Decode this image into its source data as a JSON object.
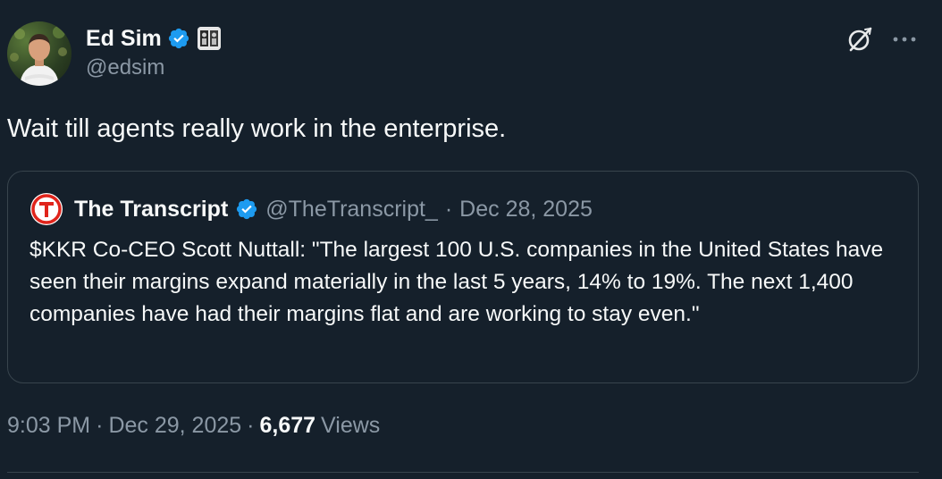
{
  "author": {
    "display_name": "Ed Sim",
    "handle": "@edsim",
    "avatar_icon": "avatar-photo",
    "verified_icon": "verified-badge-icon",
    "affiliation_icon": "affiliation-badge-icon"
  },
  "actions": {
    "grok_icon": "grok-icon",
    "more_icon": "more-icon"
  },
  "tweet": {
    "text": "Wait till agents really work in the enterprise."
  },
  "quote": {
    "display_name": "The Transcript",
    "handle": "@TheTranscript_",
    "separator": "·",
    "date": "Dec 28, 2025",
    "text": "$KKR Co-CEO Scott Nuttall: \"The largest 100 U.S. companies in the United States have seen their margins expand materially in the last 5 years, 14% to 19%. The next 1,400 companies have had their margins flat and are working to stay even.\""
  },
  "meta": {
    "time": "9:03 PM",
    "separator": "·",
    "date": "Dec 29, 2025",
    "separator2": "·",
    "views_count": "6,677",
    "views_label": "Views"
  },
  "colors": {
    "background": "#15202b",
    "text_primary": "#f7f9f9",
    "text_secondary": "#8b98a5",
    "border": "#38444d",
    "verified": "#1d9bf0",
    "transcript_red": "#e0241b"
  }
}
